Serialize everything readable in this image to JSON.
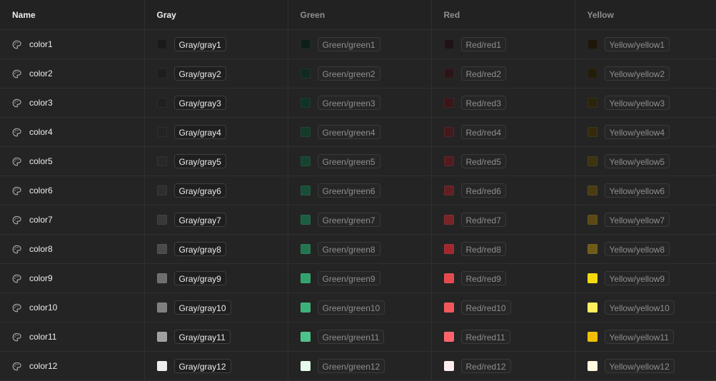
{
  "headers": [
    "Name",
    "Gray",
    "Green",
    "Red",
    "Yellow"
  ],
  "rows": [
    {
      "name": "color1",
      "cells": [
        {
          "label": "Gray/gray1",
          "color": "#1a1a1a"
        },
        {
          "label": "Green/green1",
          "color": "#0e1f18"
        },
        {
          "label": "Red/red1",
          "color": "#1f1315"
        },
        {
          "label": "Yellow/yellow1",
          "color": "#1c1708"
        }
      ]
    },
    {
      "name": "color2",
      "cells": [
        {
          "label": "Gray/gray2",
          "color": "#1d1d1d"
        },
        {
          "label": "Green/green2",
          "color": "#0f2a1e"
        },
        {
          "label": "Red/red2",
          "color": "#2a1517"
        },
        {
          "label": "Yellow/yellow2",
          "color": "#221c0a"
        }
      ]
    },
    {
      "name": "color3",
      "cells": [
        {
          "label": "Gray/gray3",
          "color": "#202020"
        },
        {
          "label": "Green/green3",
          "color": "#0f3324"
        },
        {
          "label": "Red/red3",
          "color": "#3a1619"
        },
        {
          "label": "Yellow/yellow3",
          "color": "#2b240c"
        }
      ]
    },
    {
      "name": "color4",
      "cells": [
        {
          "label": "Gray/gray4",
          "color": "#232323"
        },
        {
          "label": "Green/green4",
          "color": "#123b29"
        },
        {
          "label": "Red/red4",
          "color": "#45191c"
        },
        {
          "label": "Yellow/yellow4",
          "color": "#342b0e"
        }
      ]
    },
    {
      "name": "color5",
      "cells": [
        {
          "label": "Gray/gray5",
          "color": "#282828"
        },
        {
          "label": "Green/green5",
          "color": "#14442f"
        },
        {
          "label": "Red/red5",
          "color": "#521c1f"
        },
        {
          "label": "Yellow/yellow5",
          "color": "#3e3310"
        }
      ]
    },
    {
      "name": "color6",
      "cells": [
        {
          "label": "Gray/gray6",
          "color": "#2e2e2e"
        },
        {
          "label": "Green/green6",
          "color": "#174e36"
        },
        {
          "label": "Red/red6",
          "color": "#621f23"
        },
        {
          "label": "Yellow/yellow6",
          "color": "#4a3c12"
        }
      ]
    },
    {
      "name": "color7",
      "cells": [
        {
          "label": "Gray/gray7",
          "color": "#383838"
        },
        {
          "label": "Green/green7",
          "color": "#1b5e41"
        },
        {
          "label": "Red/red7",
          "color": "#7a2328"
        },
        {
          "label": "Yellow/yellow7",
          "color": "#5a4915"
        }
      ]
    },
    {
      "name": "color8",
      "cells": [
        {
          "label": "Gray/gray8",
          "color": "#4a4a4a"
        },
        {
          "label": "Green/green8",
          "color": "#22764f"
        },
        {
          "label": "Red/red8",
          "color": "#a0272e"
        },
        {
          "label": "Yellow/yellow8",
          "color": "#6f5a17"
        }
      ]
    },
    {
      "name": "color9",
      "cells": [
        {
          "label": "Gray/gray9",
          "color": "#6e6e6e"
        },
        {
          "label": "Green/green9",
          "color": "#30a46c"
        },
        {
          "label": "Red/red9",
          "color": "#e5484d"
        },
        {
          "label": "Yellow/yellow9",
          "color": "#f5d90a"
        }
      ]
    },
    {
      "name": "color10",
      "cells": [
        {
          "label": "Gray/gray10",
          "color": "#7e7e7e"
        },
        {
          "label": "Green/green10",
          "color": "#3cb179"
        },
        {
          "label": "Red/red10",
          "color": "#f2555a"
        },
        {
          "label": "Yellow/yellow10",
          "color": "#ffef5c"
        }
      ]
    },
    {
      "name": "color11",
      "cells": [
        {
          "label": "Gray/gray11",
          "color": "#a0a0a0"
        },
        {
          "label": "Green/green11",
          "color": "#4cc38a"
        },
        {
          "label": "Red/red11",
          "color": "#ff6369"
        },
        {
          "label": "Yellow/yellow11",
          "color": "#f0c000"
        }
      ]
    },
    {
      "name": "color12",
      "cells": [
        {
          "label": "Gray/gray12",
          "color": "#ededed"
        },
        {
          "label": "Green/green12",
          "color": "#e5fbeb"
        },
        {
          "label": "Red/red12",
          "color": "#feecee"
        },
        {
          "label": "Yellow/yellow12",
          "color": "#fffae0"
        }
      ]
    }
  ]
}
